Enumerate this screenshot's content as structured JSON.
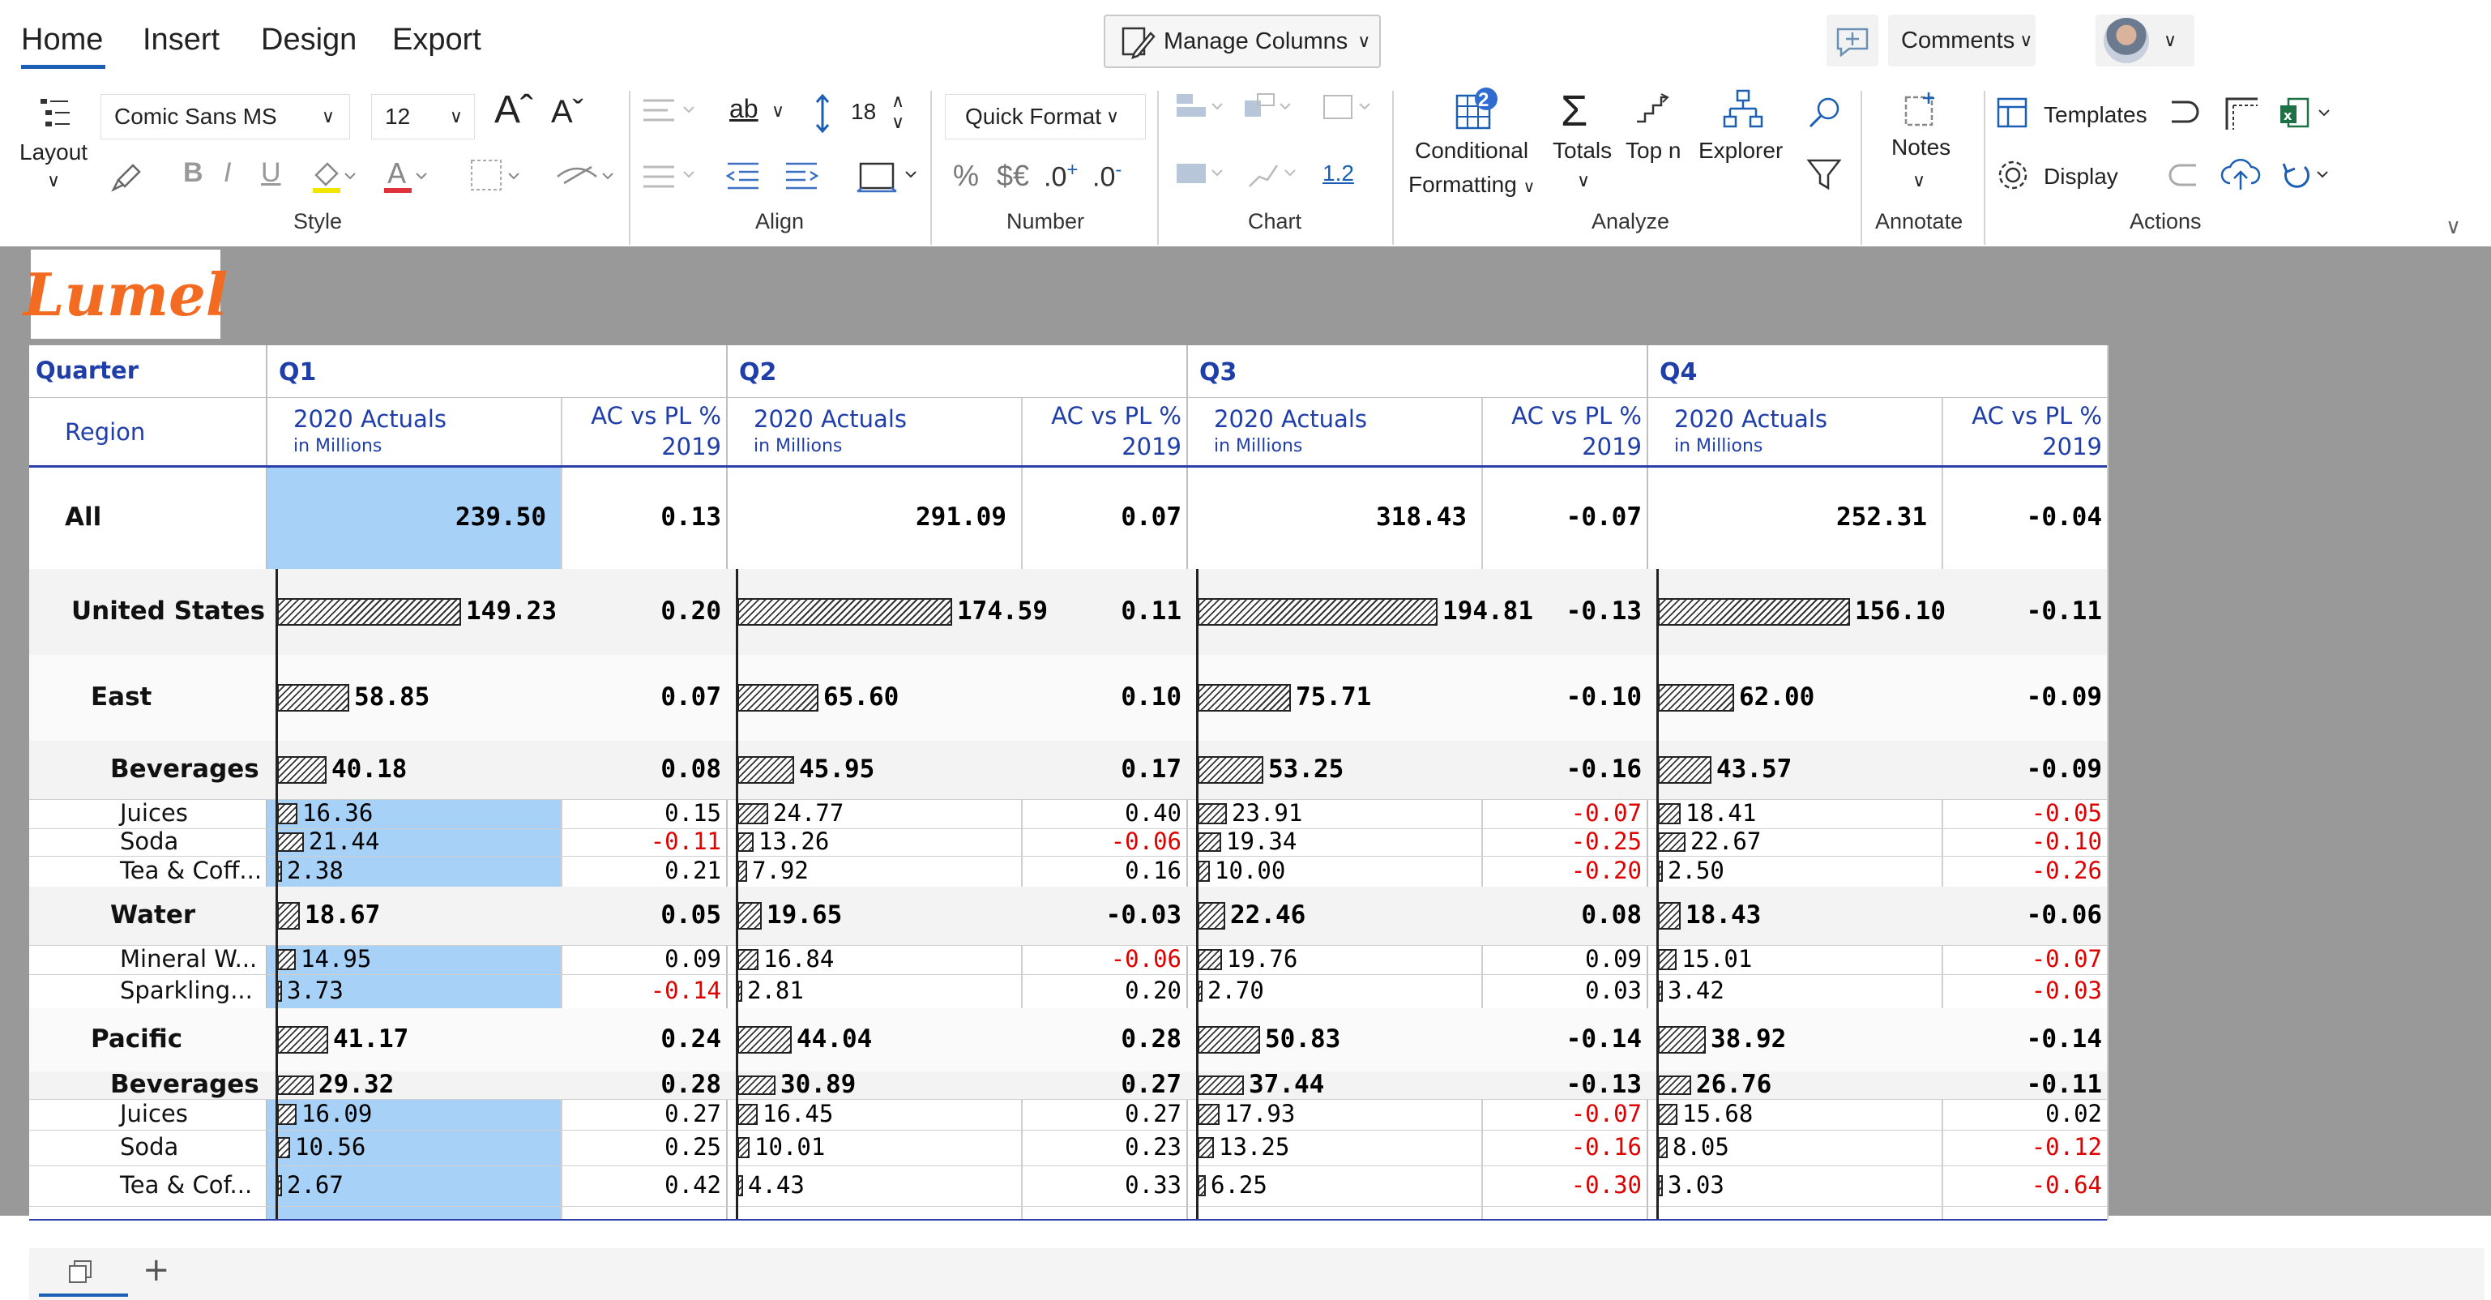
{
  "tabs": [
    "Home",
    "Insert",
    "Design",
    "Export"
  ],
  "top_buttons": {
    "manage_columns": "Manage Columns",
    "comments": "Comments"
  },
  "ribbon": {
    "layout": "Layout",
    "font_name": "Comic Sans MS",
    "font_size": "12",
    "line_height": "18",
    "quick_format": "Quick Format",
    "decimal_sample": "1.2",
    "conditional": "Conditional",
    "formatting": "Formatting",
    "totals": "Totals",
    "topn": "Top n",
    "explorer": "Explorer",
    "notes": "Notes",
    "templates": "Templates",
    "display": "Display",
    "badge": "2",
    "groups": {
      "style": "Style",
      "align": "Align",
      "number": "Number",
      "chart": "Chart",
      "analyze": "Analyze",
      "annotate": "Annotate",
      "actions": "Actions"
    }
  },
  "logo_text": "Lumel",
  "table": {
    "quarter_label": "Quarter",
    "region_label": "Region",
    "quarters": [
      "Q1",
      "Q2",
      "Q3",
      "Q4"
    ],
    "measure1": "2020 Actuals",
    "measure1_sub": "in Millions",
    "measure2": "AC vs PL %",
    "measure2_sub": "2019",
    "rows": [
      {
        "label": "All",
        "level": 0,
        "bold": true,
        "vals": [
          "239.50",
          "0.13",
          "291.09",
          "0.07",
          "318.43",
          "-0.07",
          "252.31",
          "-0.04"
        ],
        "ac": [
          239.5,
          291.09,
          318.43,
          252.31
        ]
      },
      {
        "label": "United States",
        "level": 1,
        "bold": true,
        "vals": [
          "149.23",
          "0.20",
          "174.59",
          "0.11",
          "194.81",
          "-0.13",
          "156.10",
          "-0.11"
        ],
        "ac": [
          149.23,
          174.59,
          194.81,
          156.1
        ]
      },
      {
        "label": "East",
        "level": 2,
        "bold": true,
        "vals": [
          "58.85",
          "0.07",
          "65.60",
          "0.10",
          "75.71",
          "-0.10",
          "62.00",
          "-0.09"
        ],
        "ac": [
          58.85,
          65.6,
          75.71,
          62.0
        ]
      },
      {
        "label": "Beverages",
        "level": 3,
        "bold": true,
        "vals": [
          "40.18",
          "0.08",
          "45.95",
          "0.17",
          "53.25",
          "-0.16",
          "43.57",
          "-0.09"
        ],
        "ac": [
          40.18,
          45.95,
          53.25,
          43.57
        ]
      },
      {
        "label": "Juices",
        "level": 4,
        "bold": false,
        "vals": [
          "16.36",
          "0.15",
          "24.77",
          "0.40",
          "23.91",
          "-0.07",
          "18.41",
          "-0.05"
        ],
        "ac": [
          16.36,
          24.77,
          23.91,
          18.41
        ]
      },
      {
        "label": "Soda",
        "level": 4,
        "bold": false,
        "vals": [
          "21.44",
          "-0.11",
          "13.26",
          "-0.06",
          "19.34",
          "-0.25",
          "22.67",
          "-0.10"
        ],
        "ac": [
          21.44,
          13.26,
          19.34,
          22.67
        ]
      },
      {
        "label": "Tea & Coff...",
        "level": 4,
        "bold": false,
        "vals": [
          "2.38",
          "0.21",
          "7.92",
          "0.16",
          "10.00",
          "-0.20",
          "2.50",
          "-0.26"
        ],
        "ac": [
          2.38,
          7.92,
          10.0,
          2.5
        ]
      },
      {
        "label": "Water",
        "level": 3,
        "bold": true,
        "vals": [
          "18.67",
          "0.05",
          "19.65",
          "-0.03",
          "22.46",
          "0.08",
          "18.43",
          "-0.06"
        ],
        "ac": [
          18.67,
          19.65,
          22.46,
          18.43
        ]
      },
      {
        "label": "Mineral W...",
        "level": 4,
        "bold": false,
        "vals": [
          "14.95",
          "0.09",
          "16.84",
          "-0.06",
          "19.76",
          "0.09",
          "15.01",
          "-0.07"
        ],
        "ac": [
          14.95,
          16.84,
          19.76,
          15.01
        ]
      },
      {
        "label": "Sparkling...",
        "level": 4,
        "bold": false,
        "vals": [
          "3.73",
          "-0.14",
          "2.81",
          "0.20",
          "2.70",
          "0.03",
          "3.42",
          "-0.03"
        ],
        "ac": [
          3.73,
          2.81,
          2.7,
          3.42
        ]
      },
      {
        "label": "Pacific",
        "level": 2,
        "bold": true,
        "vals": [
          "41.17",
          "0.24",
          "44.04",
          "0.28",
          "50.83",
          "-0.14",
          "38.92",
          "-0.14"
        ],
        "ac": [
          41.17,
          44.04,
          50.83,
          38.92
        ]
      },
      {
        "label": "Beverages",
        "level": 3,
        "bold": true,
        "vals": [
          "29.32",
          "0.28",
          "30.89",
          "0.27",
          "37.44",
          "-0.13",
          "26.76",
          "-0.11"
        ],
        "ac": [
          29.32,
          30.89,
          37.44,
          26.76
        ]
      },
      {
        "label": "Juices",
        "level": 4,
        "bold": false,
        "vals": [
          "16.09",
          "0.27",
          "16.45",
          "0.27",
          "17.93",
          "-0.07",
          "15.68",
          "0.02"
        ],
        "ac": [
          16.09,
          16.45,
          17.93,
          15.68
        ]
      },
      {
        "label": "Soda",
        "level": 4,
        "bold": false,
        "vals": [
          "10.56",
          "0.25",
          "10.01",
          "0.23",
          "13.25",
          "-0.16",
          "8.05",
          "-0.12"
        ],
        "ac": [
          10.56,
          10.01,
          13.25,
          8.05
        ]
      },
      {
        "label": "Tea & Cof...",
        "level": 4,
        "bold": false,
        "vals": [
          "2.67",
          "0.42",
          "4.43",
          "0.33",
          "6.25",
          "-0.30",
          "3.03",
          "-0.64"
        ],
        "ac": [
          2.67,
          4.43,
          6.25,
          3.03
        ]
      }
    ]
  }
}
